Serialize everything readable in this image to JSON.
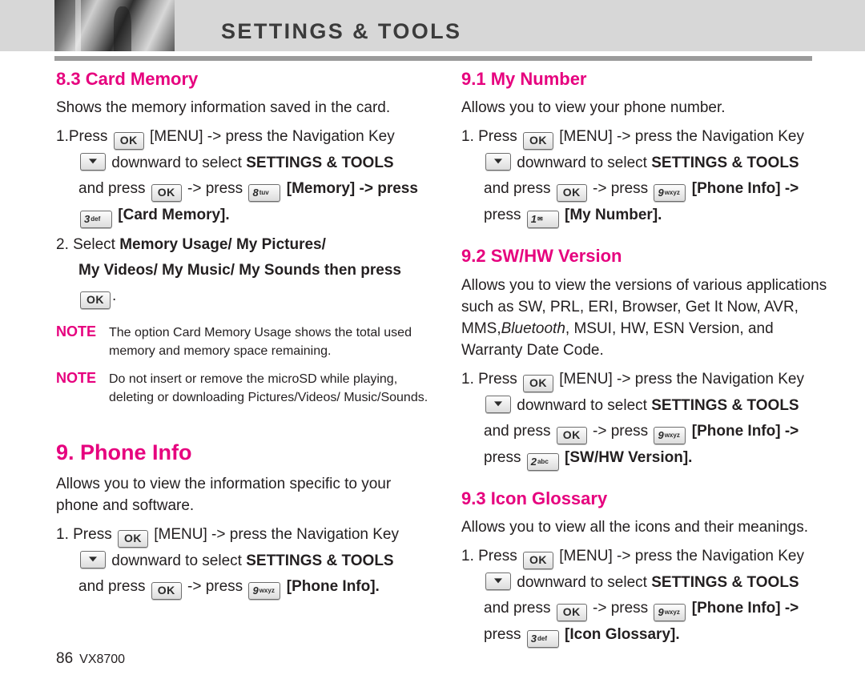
{
  "header": {
    "title": "SETTINGS & TOOLS"
  },
  "left": {
    "s83": {
      "heading": "8.3 Card Memory",
      "intro": "Shows the memory information saved in the card.",
      "step1_a": "1.Press",
      "step1_menu": "[MENU] -> press the Navigation Key",
      "step1_b": "downward to select",
      "step1_settings": "SETTINGS & TOOLS",
      "step1_c": "and press",
      "step1_d": "-> press",
      "step1_memory": "[Memory] -> press",
      "step1_cardmemory": "[Card Memory].",
      "step2_a": "2. Select",
      "step2_b": "Memory Usage/ My Pictures/",
      "step2_c": "My Videos/ My Music/ My Sounds",
      "step2_d": "then press",
      "step2_end": ".",
      "note1_label": "NOTE",
      "note1_text": "The option Card Memory Usage shows the total used memory and memory space remaining.",
      "note2_label": "NOTE",
      "note2_text": "Do not insert or remove the microSD while playing, deleting or downloading Pictures/Videos/ Music/Sounds."
    },
    "s9": {
      "heading": "9. Phone Info",
      "intro": "Allows you to view the information specific to your phone and software.",
      "step1_a": "1. Press",
      "step1_menu": "[MENU] -> press the Navigation Key",
      "step1_b": "downward to select",
      "step1_settings": "SETTINGS & TOOLS",
      "step1_c": "and press",
      "step1_d": "-> press",
      "step1_phoneinfo": "[Phone Info]."
    }
  },
  "right": {
    "s91": {
      "heading": "9.1 My Number",
      "intro": "Allows you to view your phone number.",
      "step1_a": "1. Press",
      "step1_menu": "[MENU] -> press the Navigation Key",
      "step1_b": "downward to select",
      "step1_settings": "SETTINGS & TOOLS",
      "step1_c": "and press",
      "step1_d": "-> press",
      "step1_phoneinfo": "[Phone Info] ->",
      "step1_e": "press",
      "step1_mynumber": "[My Number]."
    },
    "s92": {
      "heading": "9.2 SW/HW Version",
      "intro_1": "Allows you to view the versions of various applications such as SW, PRL, ERI, Browser, Get It Now, AVR, MMS,",
      "intro_italic": "Bluetooth",
      "intro_2": ", MSUI, HW, ESN Version, and Warranty Date Code.",
      "step1_a": "1. Press",
      "step1_menu": "[MENU] -> press the Navigation Key",
      "step1_b": "downward to select",
      "step1_settings": "SETTINGS & TOOLS",
      "step1_c": "and press",
      "step1_d": "-> press",
      "step1_phoneinfo": "[Phone Info] ->",
      "step1_e": "press",
      "step1_swhw": "[SW/HW Version]."
    },
    "s93": {
      "heading": "9.3 Icon Glossary",
      "intro": "Allows you to view all the icons and their meanings.",
      "step1_a": "1. Press",
      "step1_menu": "[MENU] -> press the Navigation Key",
      "step1_b": "downward to select",
      "step1_settings": "SETTINGS & TOOLS",
      "step1_c": "and press",
      "step1_d": "-> press",
      "step1_phoneinfo": "[Phone Info] ->",
      "step1_e": "press",
      "step1_iconglossary": "[Icon Glossary]."
    }
  },
  "keys": {
    "ok": "OK",
    "k8": {
      "num": "8",
      "sub": "tuv"
    },
    "k3": {
      "num": "3",
      "sub": "def"
    },
    "k9": {
      "num": "9",
      "sub": "wxyz"
    },
    "k1": {
      "num": "1",
      "sub": "✉"
    },
    "k2": {
      "num": "2",
      "sub": "abc"
    },
    "nav_down": "nav-down-arrow"
  },
  "footer": {
    "page": "86",
    "model": "VX8700"
  },
  "colors": {
    "accent": "#e6007e",
    "header_bg": "#d7d7d7",
    "text": "#231f20"
  }
}
